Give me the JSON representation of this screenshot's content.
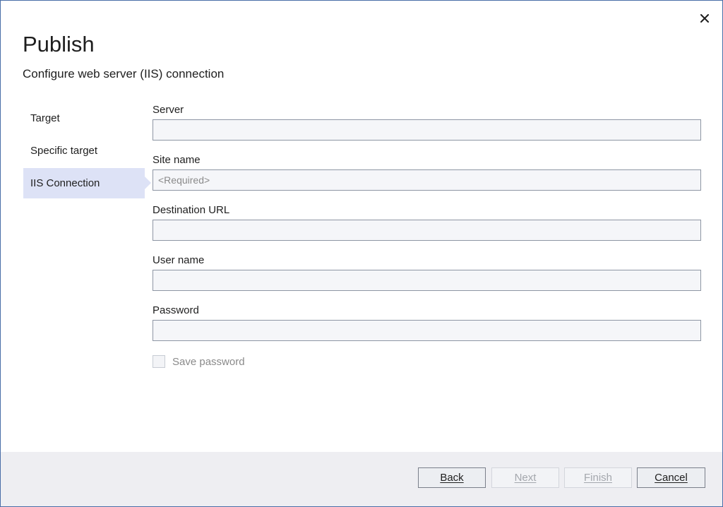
{
  "dialog": {
    "title": "Publish",
    "subtitle": "Configure web server (IIS) connection"
  },
  "nav": {
    "items": [
      {
        "label": "Target",
        "selected": false
      },
      {
        "label": "Specific target",
        "selected": false
      },
      {
        "label": "IIS Connection",
        "selected": true
      }
    ]
  },
  "form": {
    "server": {
      "label": "Server",
      "value": "",
      "placeholder": ""
    },
    "site_name": {
      "label": "Site name",
      "value": "",
      "placeholder": "<Required>"
    },
    "destination_url": {
      "label": "Destination URL",
      "value": "",
      "placeholder": ""
    },
    "user_name": {
      "label": "User name",
      "value": "",
      "placeholder": ""
    },
    "password": {
      "label": "Password",
      "value": "",
      "placeholder": ""
    },
    "save_password": {
      "label": "Save password",
      "checked": false,
      "enabled": false
    }
  },
  "footer": {
    "back_label": "Back",
    "next_label": "Next",
    "finish_label": "Finish",
    "cancel_label": "Cancel"
  },
  "colors": {
    "accent_selected_nav": "#dde2f6",
    "window_border": "#4a6ea8",
    "footer_bg": "#eeeef2"
  },
  "icons": {
    "close": "close-icon"
  }
}
